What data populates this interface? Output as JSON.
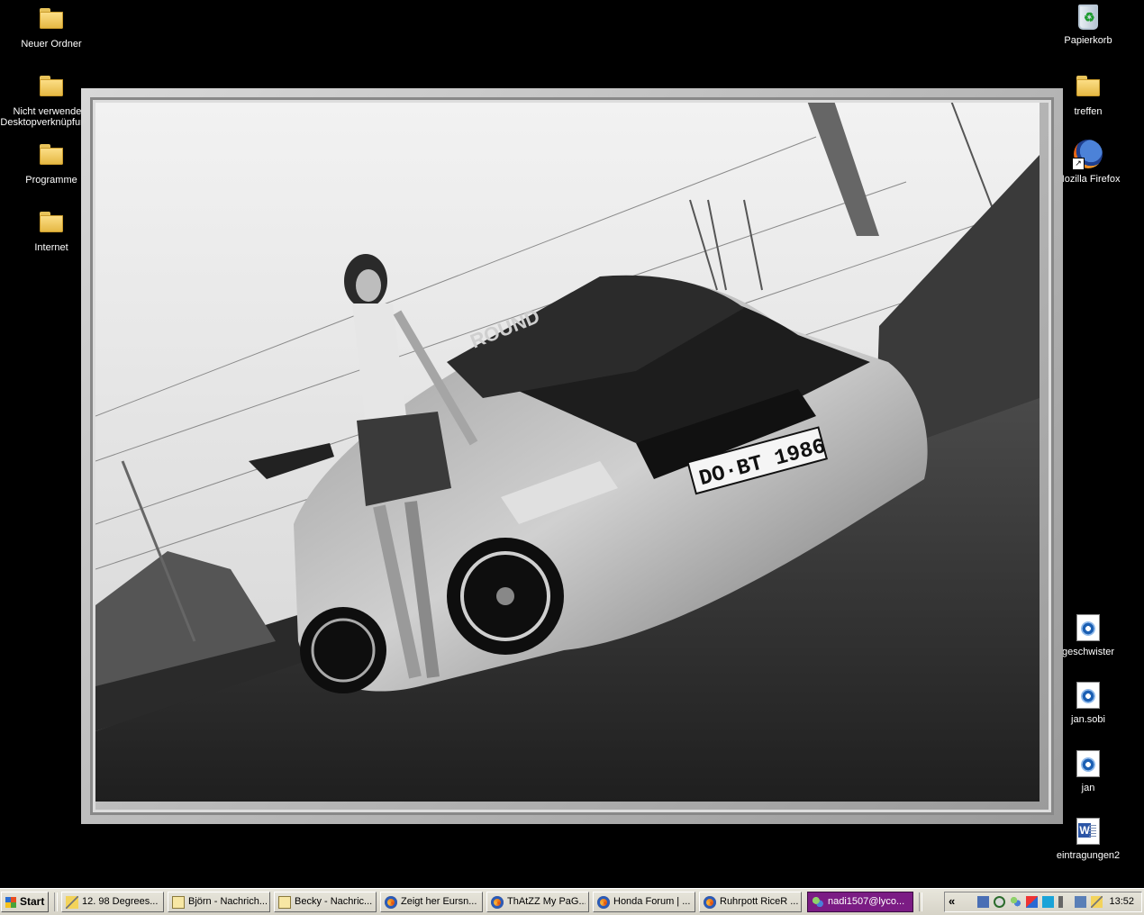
{
  "desktop": {
    "left_icons": [
      {
        "label": "Neuer Ordner",
        "icon": "folder-icon"
      },
      {
        "label": "Nicht verwendete Desktopverknüpfungen",
        "icon": "folder-icon"
      },
      {
        "label": "Programme",
        "icon": "folder-icon"
      },
      {
        "label": "Internet",
        "icon": "folder-icon"
      }
    ],
    "right_icons": [
      {
        "label": "Papierkorb",
        "icon": "recycle-bin-icon"
      },
      {
        "label": "treffen",
        "icon": "folder-icon"
      },
      {
        "label": "Mozilla Firefox",
        "icon": "firefox-icon"
      },
      {
        "label": "geschwister",
        "icon": "image-file-icon"
      },
      {
        "label": "jan.sobi",
        "icon": "image-file-icon"
      },
      {
        "label": "jan",
        "icon": "image-file-icon"
      },
      {
        "label": "eintragungen2",
        "icon": "word-document-icon"
      }
    ]
  },
  "wallpaper": {
    "license_plate": "DO·BT 1986",
    "windshield_banner": "ROUND"
  },
  "taskbar": {
    "start_label": "Start",
    "tasks": [
      {
        "label": "12. 98 Degrees...",
        "icon": "pen-icon",
        "active": false
      },
      {
        "label": "Björn - Nachrich...",
        "icon": "envelope-icon",
        "active": false
      },
      {
        "label": "Becky - Nachric...",
        "icon": "envelope-icon",
        "active": false
      },
      {
        "label": "Zeigt her Eursn...",
        "icon": "firefox-icon",
        "active": false
      },
      {
        "label": "ThAtZZ My PaG...",
        "icon": "firefox-icon",
        "active": false
      },
      {
        "label": "Honda Forum | ...",
        "icon": "firefox-icon",
        "active": false
      },
      {
        "label": "Ruhrpott RiceR ...",
        "icon": "firefox-icon",
        "active": false
      },
      {
        "label": "nadi1507@lyco...",
        "icon": "msn-icon",
        "active": true
      }
    ],
    "tray_expand": "«",
    "clock": "13:52"
  },
  "colors": {
    "desktop_bg": "#000000",
    "taskbar_bg": "#d6d3c7",
    "active_task": "#7b1c84"
  }
}
